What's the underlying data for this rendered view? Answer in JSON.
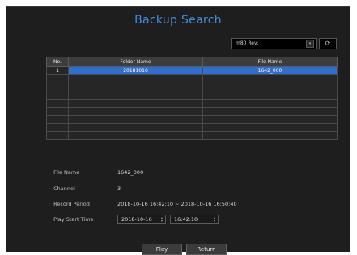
{
  "title": "Backup Search",
  "device_select": {
    "value": "m80 Rev:",
    "chevron": "▾"
  },
  "refresh_icon": "⟳",
  "table": {
    "headers": [
      "No.",
      "Folder Name",
      "File Name"
    ],
    "rows": [
      {
        "no": "1",
        "folder": "20181016",
        "file": "1642_000",
        "selected": true
      },
      {
        "no": "",
        "folder": "",
        "file": ""
      },
      {
        "no": "",
        "folder": "",
        "file": ""
      },
      {
        "no": "",
        "folder": "",
        "file": ""
      },
      {
        "no": "",
        "folder": "",
        "file": ""
      },
      {
        "no": "",
        "folder": "",
        "file": ""
      },
      {
        "no": "",
        "folder": "",
        "file": ""
      },
      {
        "no": "",
        "folder": "",
        "file": ""
      },
      {
        "no": "",
        "folder": "",
        "file": ""
      }
    ]
  },
  "info": {
    "file_name_label": "File Name",
    "file_name_value": "1642_000",
    "channel_label": "Channel",
    "channel_value": "3",
    "record_period_label": "Record Period",
    "record_period_value": "2018-10-16 16:42:10 ~ 2018-10-16 16:50:40",
    "play_start_label": "Play Start Time",
    "play_start_date": "2018-10-16",
    "play_start_time": "16:42:10"
  },
  "buttons": {
    "play": "Play",
    "return": "Return"
  },
  "colors": {
    "accent": "#3e8de0",
    "selection": "#2f6fd1",
    "background": "#1e1e1e"
  }
}
